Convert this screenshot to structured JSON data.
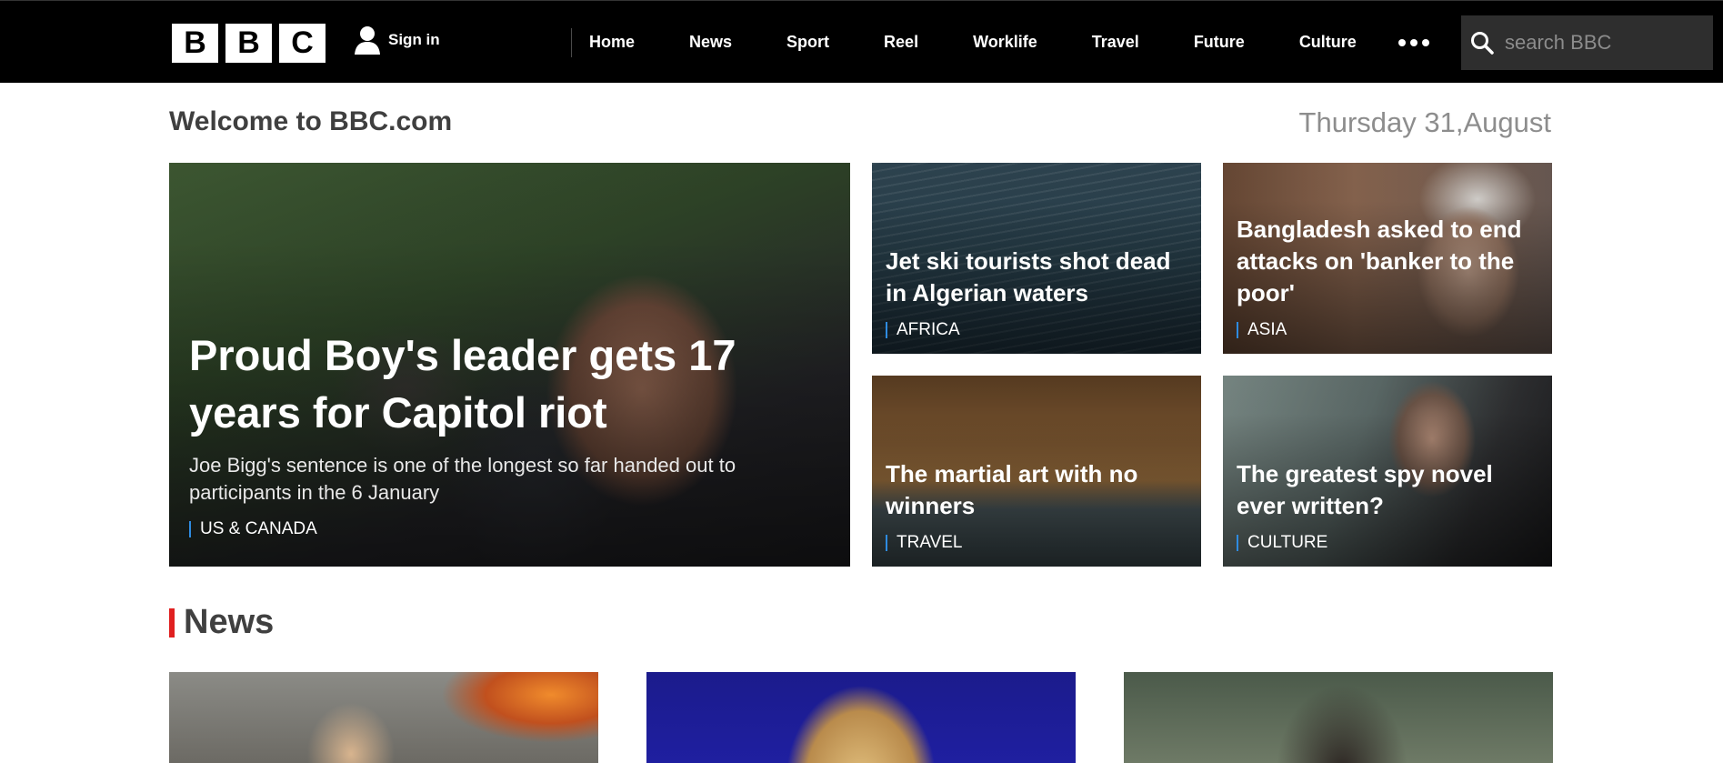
{
  "header": {
    "logo_letters": [
      "B",
      "B",
      "C"
    ],
    "sign_in": "Sign in",
    "nav": [
      "Home",
      "News",
      "Sport",
      "Reel",
      "Worklife",
      "Travel",
      "Future",
      "Culture"
    ],
    "search_placeholder": "search BBC"
  },
  "welcome": {
    "title": "Welcome to BBC.com",
    "date": "Thursday 31,August"
  },
  "hero": {
    "headline": "Proud Boy's leader gets 17 years for Capitol riot",
    "summary": "Joe Bigg's sentence is one of the longest so far handed out to participants in the 6 January",
    "tag": "US & CANADA"
  },
  "tiles": [
    {
      "headline": "Jet ski tourists shot dead in Algerian waters",
      "tag": "AFRICA"
    },
    {
      "headline": "Bangladesh asked to end attacks on 'banker to the poor'",
      "tag": "ASIA"
    },
    {
      "headline": "The martial art with no winners",
      "tag": "TRAVEL"
    },
    {
      "headline": "The greatest spy novel ever written?",
      "tag": "CULTURE"
    }
  ],
  "news_section": {
    "title": "News"
  },
  "colors": {
    "topbar": "#000000",
    "tag_accent": "#2e8be0",
    "section_accent": "#e02020"
  },
  "icons": [
    "user-icon",
    "more-dots-icon",
    "search-icon"
  ]
}
